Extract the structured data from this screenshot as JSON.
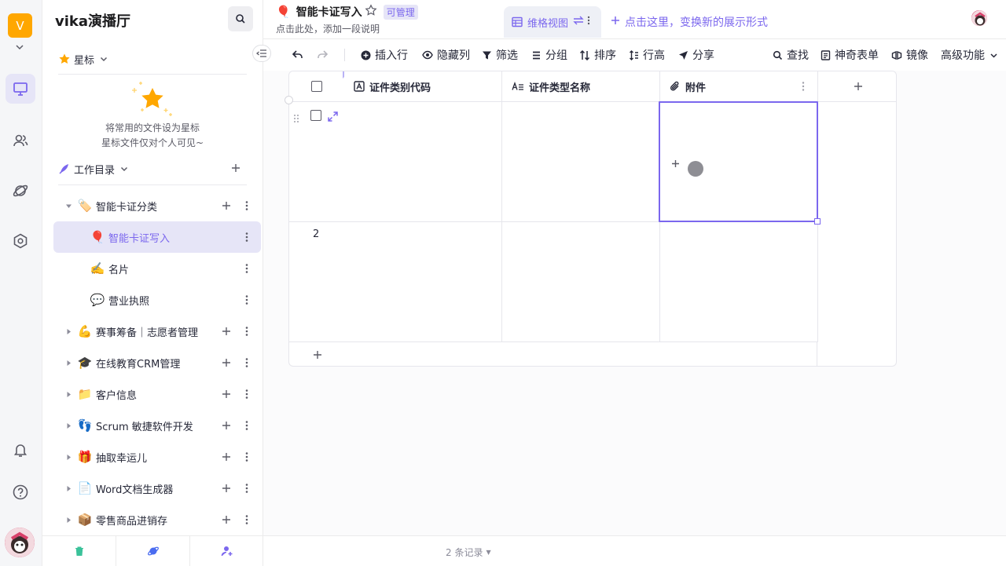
{
  "workspace": {
    "initial": "V"
  },
  "sidebar": {
    "space_name": "vika演播厅",
    "starred_label": "星标",
    "starred_hint_1": "将常用的文件设为星标",
    "starred_hint_2": "星标文件仅对个人可见~",
    "catalog_label": "工作目录",
    "tree": [
      {
        "label": "智能卡证分类",
        "emoji": "🏷️",
        "level": 0,
        "expanded": true,
        "has_add": true
      },
      {
        "label": "智能卡证写入",
        "emoji": "🎈",
        "level": 1,
        "selected": true
      },
      {
        "label": "名片",
        "emoji": "✍️",
        "level": 1
      },
      {
        "label": "营业执照",
        "emoji": "💬",
        "level": 1
      },
      {
        "label": "赛事筹备｜志愿者管理",
        "emoji": "💪",
        "level": 0,
        "has_add": true
      },
      {
        "label": "在线教育CRM管理",
        "emoji": "🎓",
        "level": 0,
        "has_add": true
      },
      {
        "label": "客户信息",
        "emoji": "📁",
        "level": 0,
        "has_add": true
      },
      {
        "label": "Scrum 敏捷软件开发",
        "emoji": "👣",
        "level": 0,
        "has_add": true
      },
      {
        "label": "抽取幸运儿",
        "emoji": "🎁",
        "level": 0,
        "has_add": true
      },
      {
        "label": "Word文档生成器",
        "emoji": "📄",
        "level": 0,
        "has_add": true
      },
      {
        "label": "零售商品进销存",
        "emoji": "📦",
        "level": 0,
        "has_add": true
      }
    ]
  },
  "datasheet": {
    "emoji": "🎈",
    "title": "智能卡证写入",
    "permission": "可管理",
    "description": "点击此处，添加一段说明"
  },
  "views": {
    "active": "维格视图",
    "add_label": "点击这里，变换新的展示形式"
  },
  "toolbar": {
    "insert_row": "插入行",
    "hide_fields": "隐藏列",
    "filter": "筛选",
    "group": "分组",
    "sort": "排序",
    "row_height": "行高",
    "share": "分享",
    "find": "查找",
    "form": "神奇表单",
    "mirror": "镜像",
    "advanced": "高级功能"
  },
  "grid": {
    "columns": [
      {
        "name": "证件类别代码",
        "icon": "text-icon"
      },
      {
        "name": "证件类型名称",
        "icon": "long-text-icon"
      },
      {
        "name": "附件",
        "icon": "attachment-icon"
      }
    ],
    "rows": [
      {
        "num": "",
        "cells": [
          "",
          "",
          ""
        ]
      },
      {
        "num": "2",
        "cells": [
          "",
          "",
          ""
        ]
      }
    ]
  },
  "footer": {
    "record_count": "2 条记录"
  },
  "colors": {
    "accent": "#7b67ee",
    "workspace_badge": "#ffa700",
    "selected_bg": "#e6e5f7"
  }
}
